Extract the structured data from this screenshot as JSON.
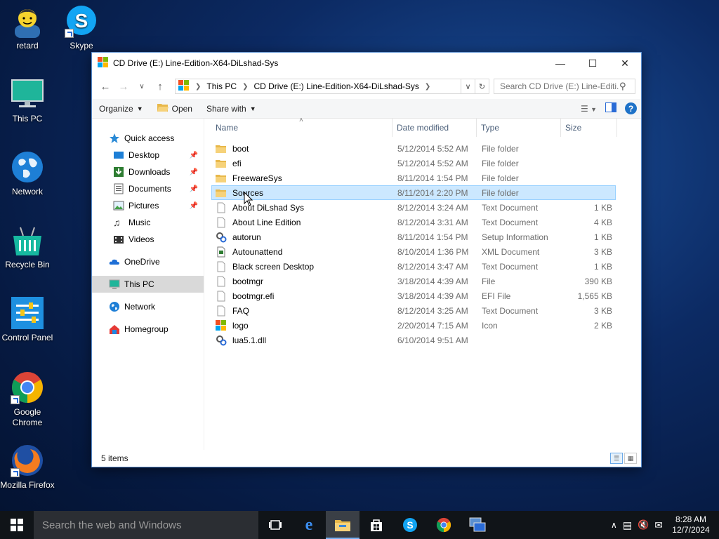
{
  "desktop": {
    "icons": [
      {
        "label": "retard"
      },
      {
        "label": "Skype"
      },
      {
        "label": "This PC"
      },
      {
        "label": "Network"
      },
      {
        "label": "Recycle Bin"
      },
      {
        "label": "Control Panel"
      },
      {
        "label": "Google Chrome"
      },
      {
        "label": "Mozilla Firefox"
      }
    ]
  },
  "window": {
    "title": "CD Drive (E:) Line-Edition-X64-DiLshad-Sys",
    "address": {
      "crumbs": [
        "This PC",
        "CD Drive (E:) Line-Edition-X64-DiLshad-Sys"
      ]
    },
    "search": {
      "placeholder": "Search CD Drive (E:) Line-Editi..."
    },
    "toolbar": {
      "organize": "Organize",
      "open": "Open",
      "share_with": "Share with"
    },
    "nav": {
      "quick_access": "Quick access",
      "desktop": "Desktop",
      "downloads": "Downloads",
      "documents": "Documents",
      "pictures": "Pictures",
      "music": "Music",
      "videos": "Videos",
      "onedrive": "OneDrive",
      "this_pc": "This PC",
      "network": "Network",
      "homegroup": "Homegroup"
    },
    "columns": {
      "name": "Name",
      "date": "Date modified",
      "type": "Type",
      "size": "Size"
    },
    "files": [
      {
        "name": "boot",
        "date": "5/12/2014 5:52 AM",
        "type": "File folder",
        "size": "",
        "icon": "folder-icon"
      },
      {
        "name": "efi",
        "date": "5/12/2014 5:52 AM",
        "type": "File folder",
        "size": "",
        "icon": "folder-icon"
      },
      {
        "name": "FreewareSys",
        "date": "8/11/2014 1:54 PM",
        "type": "File folder",
        "size": "",
        "icon": "folder-icon"
      },
      {
        "name": "Sources",
        "date": "8/11/2014 2:20 PM",
        "type": "File folder",
        "size": "",
        "icon": "folder-icon",
        "selected": true
      },
      {
        "name": "About DiLshad Sys",
        "date": "8/12/2014 3:24 AM",
        "type": "Text Document",
        "size": "1 KB",
        "icon": "document-icon"
      },
      {
        "name": "About Line Edition",
        "date": "8/12/2014 3:31 AM",
        "type": "Text Document",
        "size": "4 KB",
        "icon": "document-icon"
      },
      {
        "name": "autorun",
        "date": "8/11/2014 1:54 PM",
        "type": "Setup Information",
        "size": "1 KB",
        "icon": "gear-file-icon"
      },
      {
        "name": "Autounattend",
        "date": "8/10/2014 1:36 PM",
        "type": "XML Document",
        "size": "3 KB",
        "icon": "xml-file-icon"
      },
      {
        "name": "Black screen Desktop",
        "date": "8/12/2014 3:47 AM",
        "type": "Text Document",
        "size": "1 KB",
        "icon": "document-icon"
      },
      {
        "name": "bootmgr",
        "date": "3/18/2014 4:39 AM",
        "type": "File",
        "size": "390 KB",
        "icon": "document-icon"
      },
      {
        "name": "bootmgr.efi",
        "date": "3/18/2014 4:39 AM",
        "type": "EFI File",
        "size": "1,565 KB",
        "icon": "document-icon"
      },
      {
        "name": "FAQ",
        "date": "8/12/2014 3:25 AM",
        "type": "Text Document",
        "size": "3 KB",
        "icon": "document-icon"
      },
      {
        "name": "logo",
        "date": "2/20/2014 7:15 AM",
        "type": "Icon",
        "size": "2 KB",
        "icon": "windows-logo-icon"
      },
      {
        "name": "lua5.1.dll",
        "date": "6/10/2014 9:51 AM",
        "type": "",
        "size": "",
        "icon": "gear-file-icon"
      }
    ],
    "status": "5 items"
  },
  "taskbar": {
    "search_placeholder": "Search the web and Windows",
    "time": "8:28 AM",
    "date": "12/7/2024"
  }
}
